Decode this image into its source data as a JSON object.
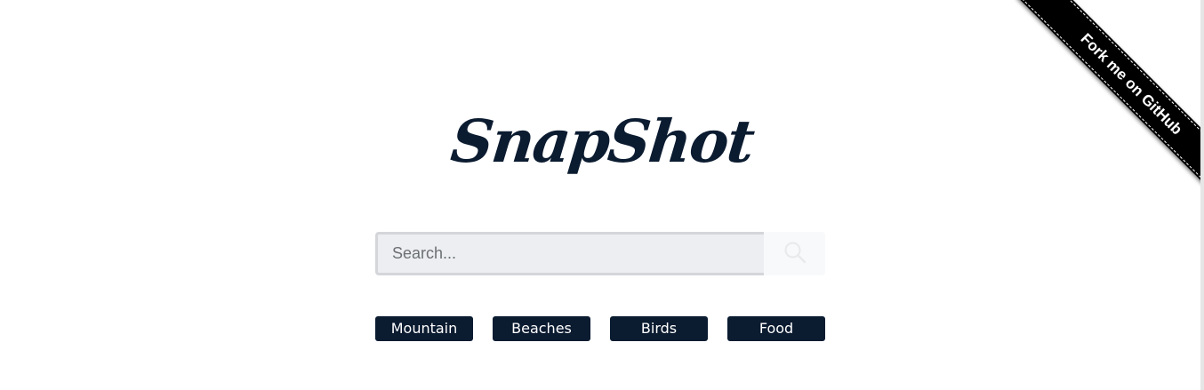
{
  "logo": {
    "text": "SnapShot"
  },
  "search": {
    "placeholder": "Search...",
    "value": "",
    "button_icon": "search-icon"
  },
  "categories": [
    {
      "label": "Mountain"
    },
    {
      "label": "Beaches"
    },
    {
      "label": "Birds"
    },
    {
      "label": "Food"
    }
  ],
  "ribbon": {
    "label": "Fork me on GitHub"
  },
  "colors": {
    "brand": "#0b1b30",
    "ribbon": "#000000",
    "input_bg": "#eceef1"
  }
}
